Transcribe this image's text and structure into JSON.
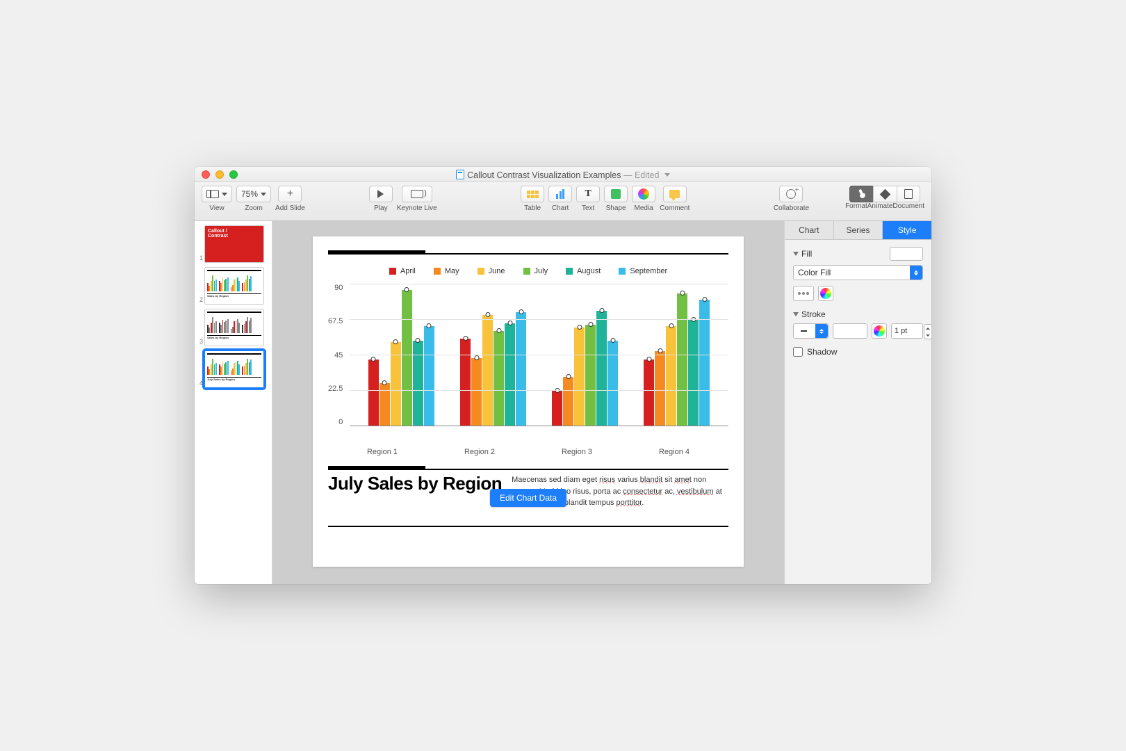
{
  "window": {
    "title": "Callout Contrast Visualization Examples",
    "edited_suffix": "— Edited"
  },
  "toolbar": {
    "view": {
      "label": "View"
    },
    "zoom": {
      "label": "Zoom",
      "value": "75%"
    },
    "add_slide": {
      "label": "Add Slide"
    },
    "play": {
      "label": "Play"
    },
    "keynote_live": {
      "label": "Keynote Live"
    },
    "table": {
      "label": "Table"
    },
    "chart": {
      "label": "Chart"
    },
    "text": {
      "label": "Text"
    },
    "shape": {
      "label": "Shape"
    },
    "media": {
      "label": "Media"
    },
    "comment": {
      "label": "Comment"
    },
    "collaborate": {
      "label": "Collaborate"
    },
    "format": {
      "label": "Format"
    },
    "animate": {
      "label": "Animate"
    },
    "document": {
      "label": "Document"
    }
  },
  "sidebar": {
    "slides": [
      {
        "num": "1",
        "title": "Callout / Contrast"
      },
      {
        "num": "2",
        "title": "Sales by Region"
      },
      {
        "num": "3",
        "title": "Sales by Region"
      },
      {
        "num": "4",
        "title": "July Sales by Region"
      }
    ],
    "selected": 3
  },
  "slide": {
    "title": "July Sales by Region",
    "body": "Maecenas sed diam eget risus varius blandit sit amet non magna. Morbi leo risus, porta ac consectetur ac, vestibulum at eros. Curabitur blandit tempus porttitor.",
    "edit_chart_label": "Edit Chart Data"
  },
  "inspector": {
    "tabs": [
      "Chart",
      "Series",
      "Style"
    ],
    "active_tab": 2,
    "fill": {
      "label": "Fill",
      "type": "Color Fill"
    },
    "stroke": {
      "label": "Stroke",
      "width": "1 pt"
    },
    "shadow": {
      "label": "Shadow",
      "checked": false
    }
  },
  "chart_data": {
    "type": "bar",
    "title": "",
    "ylim": [
      0,
      90
    ],
    "yticks": [
      0,
      22.5,
      45,
      67.5,
      90
    ],
    "categories": [
      "Region 1",
      "Region 2",
      "Region 3",
      "Region 4"
    ],
    "series": [
      {
        "name": "April",
        "color": "#d62020",
        "values": [
          42,
          55,
          22,
          42
        ]
      },
      {
        "name": "May",
        "color": "#f58a20",
        "values": [
          27,
          43,
          31,
          47
        ]
      },
      {
        "name": "June",
        "color": "#f8c23a",
        "values": [
          53,
          70,
          62,
          63
        ]
      },
      {
        "name": "July",
        "color": "#72c043",
        "values": [
          86,
          60,
          64,
          84
        ]
      },
      {
        "name": "August",
        "color": "#1fb39a",
        "values": [
          54,
          65,
          73,
          67
        ]
      },
      {
        "name": "September",
        "color": "#3abce8",
        "values": [
          63,
          72,
          54,
          80
        ]
      }
    ]
  }
}
